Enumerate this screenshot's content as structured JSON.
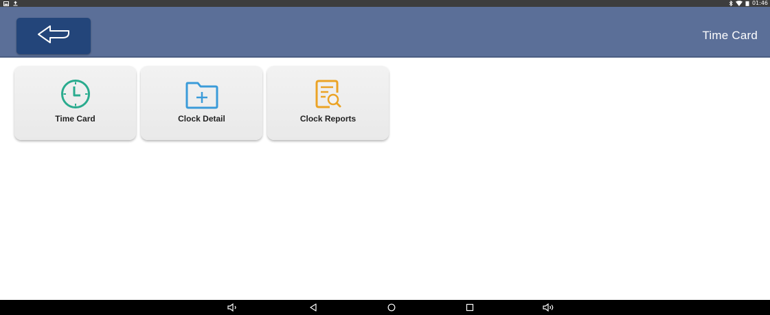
{
  "status_bar": {
    "time": "01:46",
    "left_icons": [
      "gallery-notification-icon",
      "upload-notification-icon"
    ],
    "right_icons": [
      "bluetooth-icon",
      "wifi-icon",
      "battery-icon"
    ]
  },
  "app_bar": {
    "title": "Time Card",
    "back_icon": "back-arrow-icon",
    "color": "#5b6f98",
    "back_button_color": "#23457a"
  },
  "tiles": [
    {
      "label": "Time Card",
      "icon": "clock-icon",
      "icon_color": "#2aab8e"
    },
    {
      "label": "Clock Detail",
      "icon": "folder-add-icon",
      "icon_color": "#3a9bd9"
    },
    {
      "label": "Clock Reports",
      "icon": "report-search-icon",
      "icon_color": "#eba325"
    }
  ],
  "nav_bar": {
    "buttons": [
      "volume-down-icon",
      "back-triangle-icon",
      "home-circle-icon",
      "recents-square-icon",
      "volume-up-icon"
    ]
  }
}
